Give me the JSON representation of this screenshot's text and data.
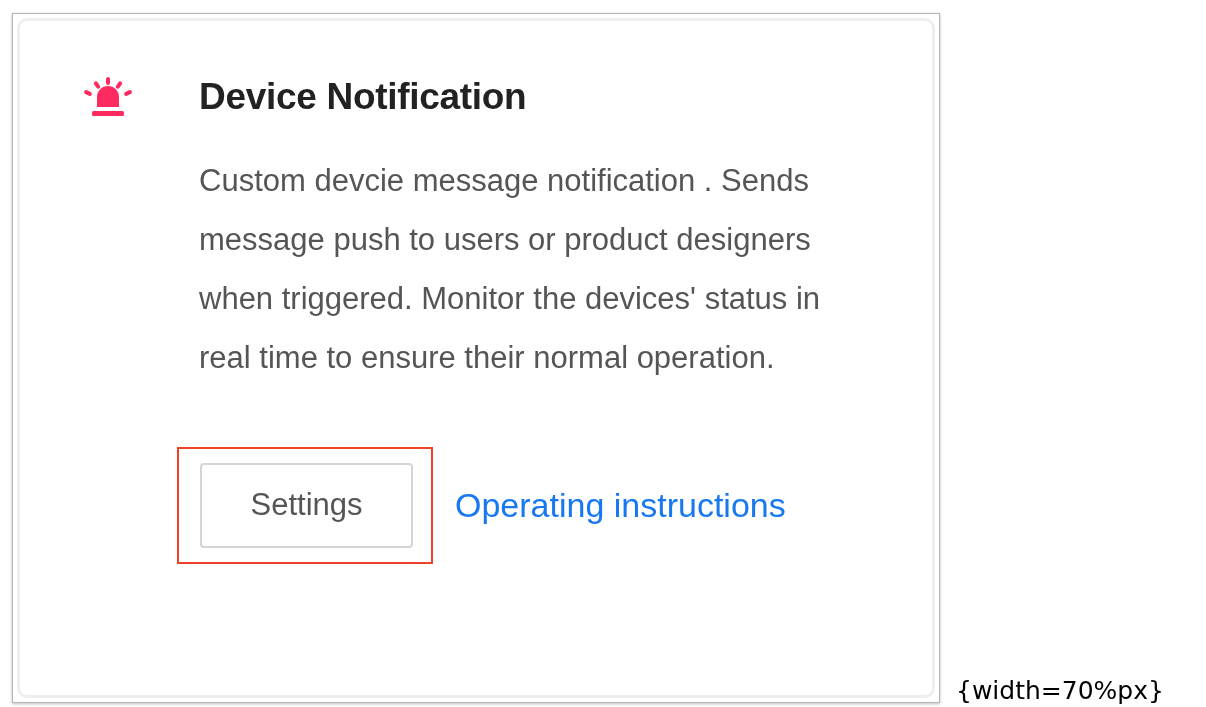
{
  "card": {
    "title": "Device Notification",
    "description": "Custom devcie message notification . Sends message push to users or product designers when triggered. Monitor the devices' status in real time to ensure their normal operation.",
    "settings_button": {
      "label": "Settings",
      "highlighted": true
    },
    "link": "Operating instructions"
  },
  "caption": "{width=70%px}"
}
